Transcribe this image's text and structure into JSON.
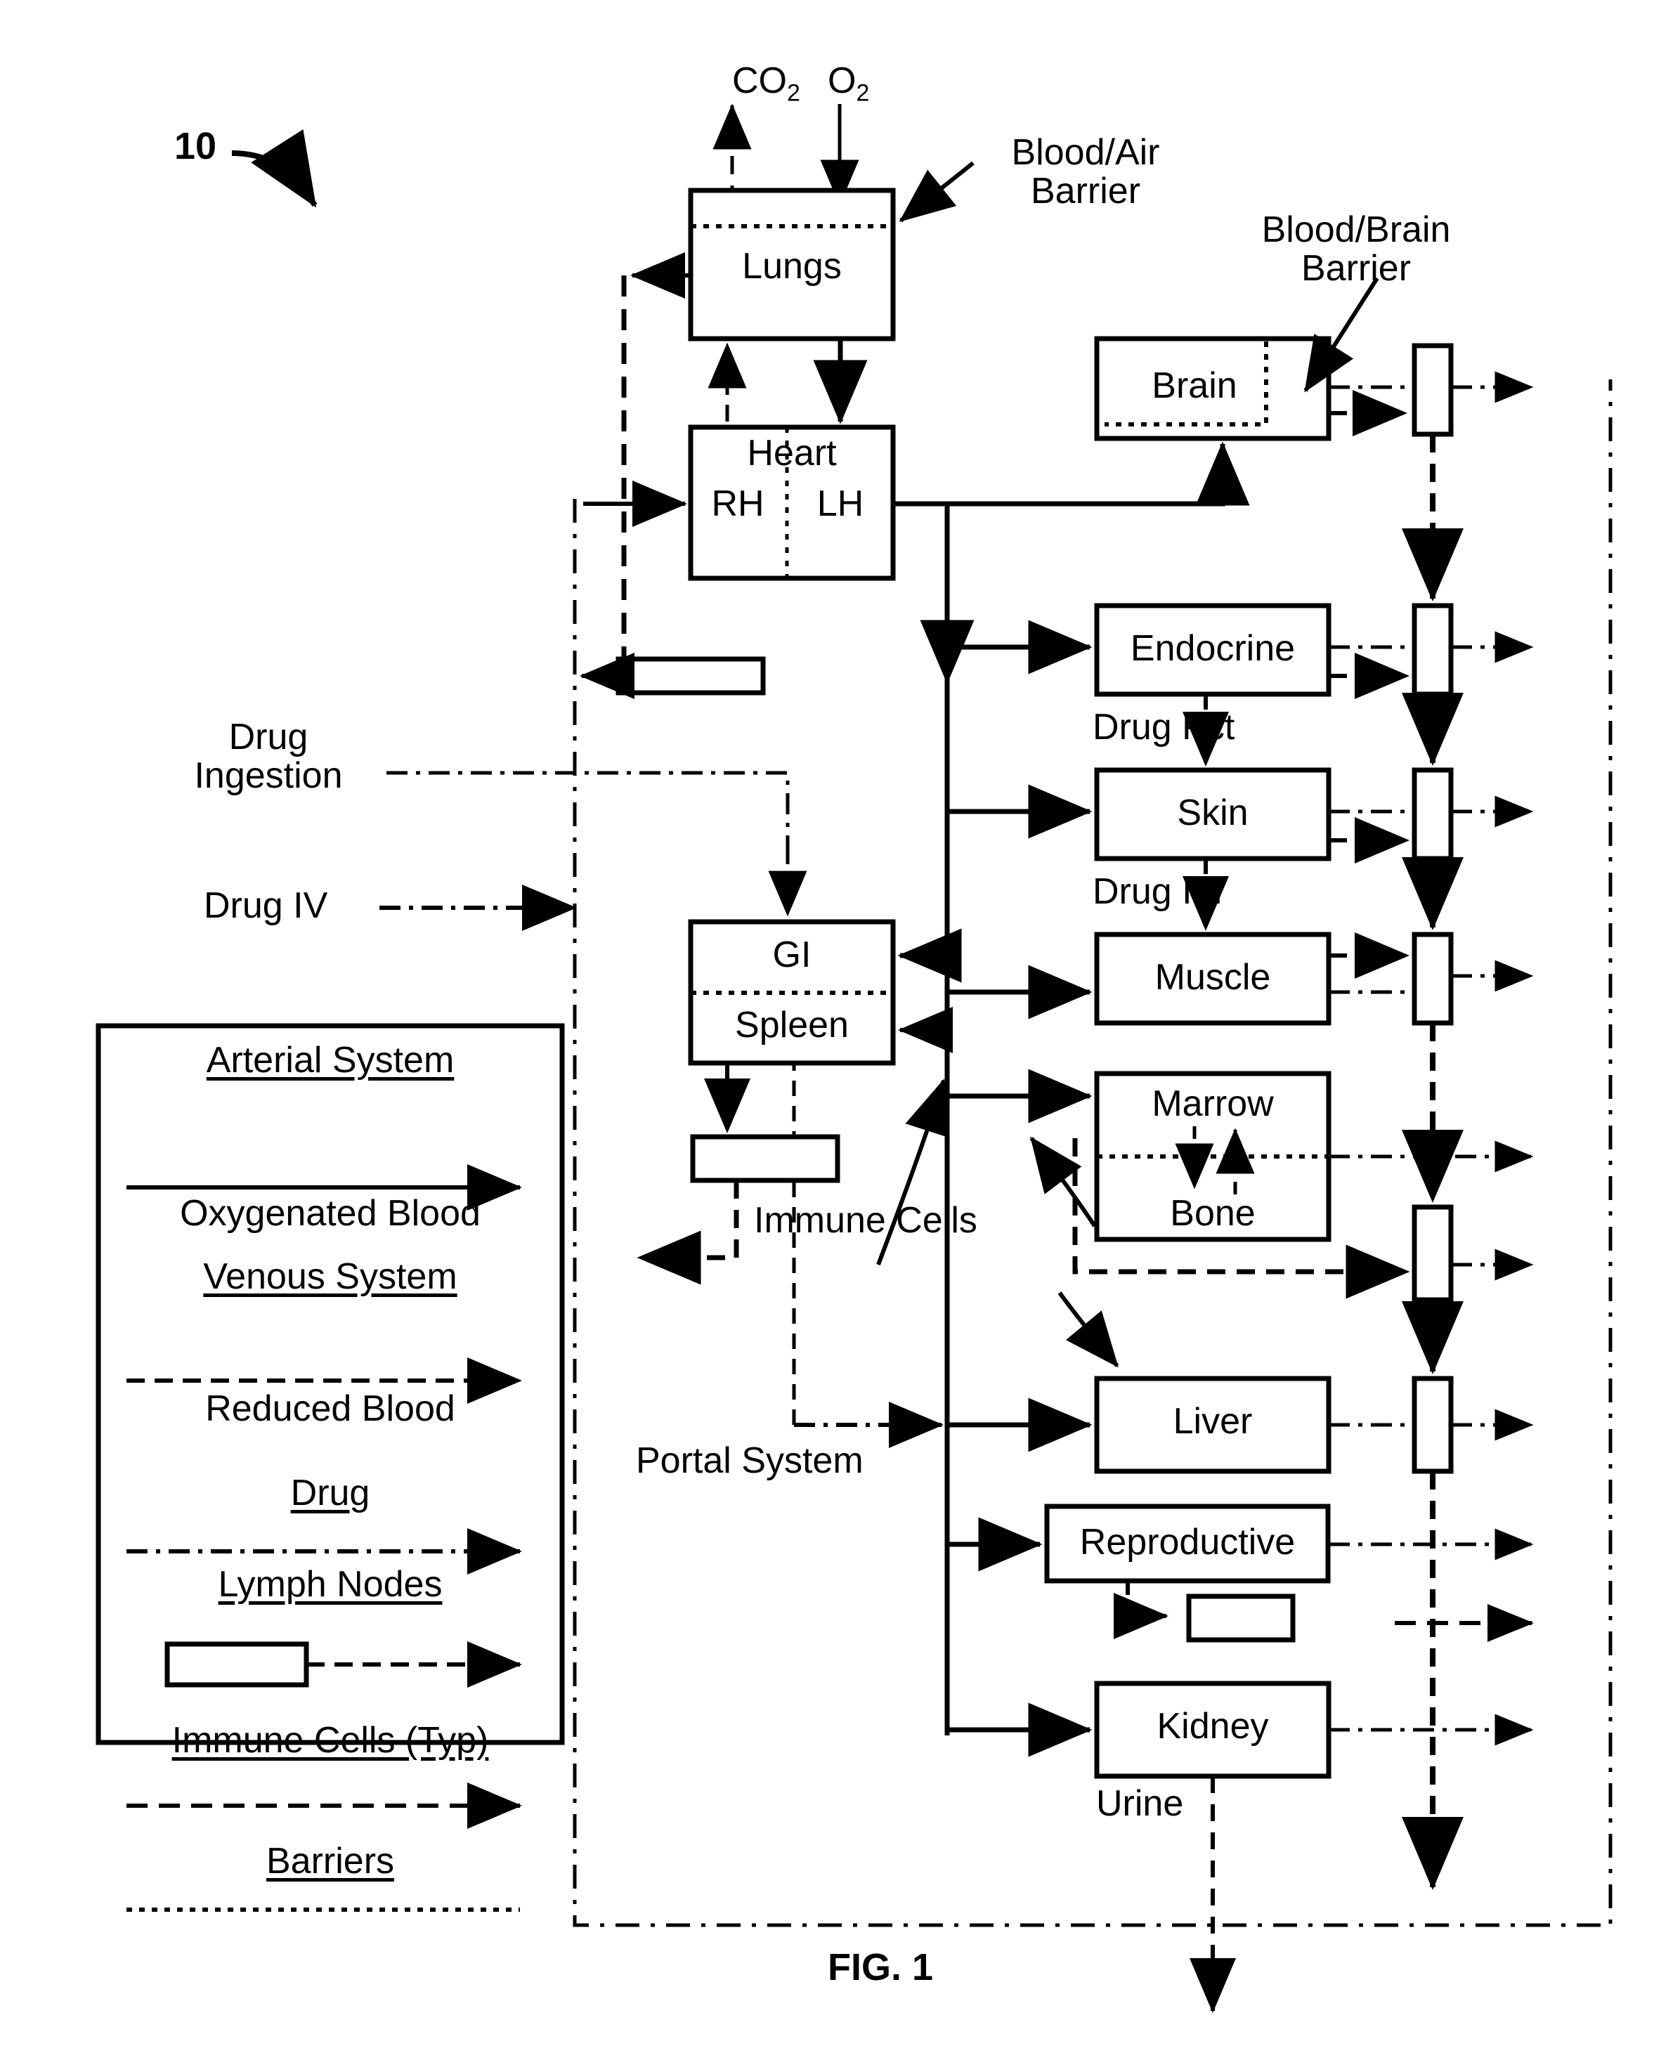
{
  "figure": {
    "reference_numeral": "10",
    "caption": "FIG. 1"
  },
  "gas_labels": {
    "co2": "CO2",
    "co2_html": "CO",
    "co2_sub": "2",
    "o2_html": "O",
    "o2_sub": "2"
  },
  "callouts": {
    "blood_air_barrier": "Blood/Air\nBarrier",
    "blood_air_barrier_line1": "Blood/Air",
    "blood_air_barrier_line2": "Barrier",
    "blood_brain_barrier_line1": "Blood/Brain",
    "blood_brain_barrier_line2": "Barrier"
  },
  "inputs": {
    "drug_ingestion_line1": "Drug",
    "drug_ingestion_line2": "Ingestion",
    "drug_iv": "Drug IV"
  },
  "organs": {
    "lungs": "Lungs",
    "heart": "Heart",
    "heart_right": "RH",
    "heart_left": "LH",
    "brain": "Brain",
    "endocrine": "Endocrine",
    "skin": "Skin",
    "muscle": "Muscle",
    "marrow": "Marrow",
    "bone": "Bone",
    "liver": "Liver",
    "reproductive": "Reproductive",
    "kidney": "Kidney",
    "gi": "GI",
    "spleen": "Spleen"
  },
  "flow_labels": {
    "drug_pct": "Drug Pct",
    "drug_im": "Drug IM",
    "urine": "Urine",
    "portal_system": "Portal System",
    "immune_cells": "Immune Cells"
  },
  "legend": {
    "sections": [
      {
        "heading": "Arterial System",
        "item": "Oxygenated Blood",
        "line_style": "solid-arrow"
      },
      {
        "heading": "Venous System",
        "item": "Reduced Blood",
        "line_style": "dashed-arrow"
      },
      {
        "heading": "Drug",
        "item": "",
        "line_style": "dashdot-arrow"
      },
      {
        "heading": "Lymph Nodes",
        "item": "",
        "line_style": "node-box-dashed-arrow"
      },
      {
        "heading": "Immune Cells (Typ)",
        "item": "",
        "line_style": "longdash-arrow"
      },
      {
        "heading": "Barriers",
        "item": "",
        "line_style": "dotted-line"
      }
    ]
  },
  "colors": {
    "ink": "#000000",
    "paper": "#ffffff"
  }
}
